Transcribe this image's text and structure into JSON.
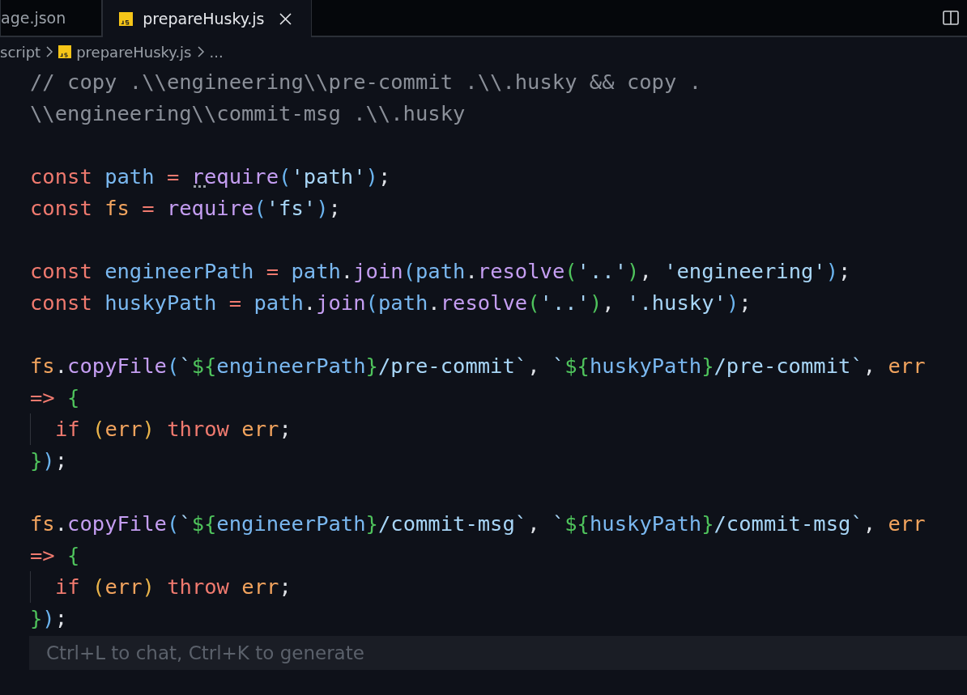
{
  "tabs": [
    {
      "label": "age.json",
      "selected": false,
      "kind": "plain"
    },
    {
      "label": "prepareHusky.js",
      "selected": true,
      "kind": "js"
    }
  ],
  "breadcrumb": [
    {
      "label": "script",
      "kind": "folder"
    },
    {
      "label": "prepareHusky.js",
      "kind": "js"
    },
    {
      "label": "...",
      "kind": "more"
    }
  ],
  "code_lines": [
    {
      "kind": "code",
      "guide": false,
      "tokens": [
        {
          "text": "// copy .\\\\engineering\\\\pre-commit .\\\\.husky && copy .",
          "kind": "comment"
        }
      ]
    },
    {
      "kind": "code",
      "guide": false,
      "tokens": [
        {
          "text": "\\\\engineering\\\\commit-msg .\\\\.husky",
          "kind": "comment"
        }
      ]
    },
    {
      "kind": "blank"
    },
    {
      "kind": "code",
      "guide": false,
      "hint": true,
      "tokens": [
        {
          "text": "const ",
          "kind": "keyword"
        },
        {
          "text": "path ",
          "kind": "variable"
        },
        {
          "text": "= ",
          "kind": "keyword"
        },
        {
          "text": "require",
          "kind": "function"
        },
        {
          "text": "(",
          "kind": "paren"
        },
        {
          "text": "'path'",
          "kind": "string"
        },
        {
          "text": ")",
          "kind": "paren"
        },
        {
          "text": ";",
          "kind": "punct"
        }
      ]
    },
    {
      "kind": "code",
      "guide": false,
      "tokens": [
        {
          "text": "const ",
          "kind": "keyword"
        },
        {
          "text": "fs ",
          "kind": "param"
        },
        {
          "text": "= ",
          "kind": "keyword"
        },
        {
          "text": "require",
          "kind": "function"
        },
        {
          "text": "(",
          "kind": "paren"
        },
        {
          "text": "'fs'",
          "kind": "string"
        },
        {
          "text": ")",
          "kind": "paren"
        },
        {
          "text": ";",
          "kind": "punct"
        }
      ]
    },
    {
      "kind": "blank"
    },
    {
      "kind": "code",
      "guide": false,
      "tokens": [
        {
          "text": "const ",
          "kind": "keyword"
        },
        {
          "text": "engineerPath ",
          "kind": "variable"
        },
        {
          "text": "= ",
          "kind": "keyword"
        },
        {
          "text": "path",
          "kind": "variable"
        },
        {
          "text": ".",
          "kind": "punct"
        },
        {
          "text": "join",
          "kind": "function"
        },
        {
          "text": "(",
          "kind": "paren"
        },
        {
          "text": "path",
          "kind": "variable"
        },
        {
          "text": ".",
          "kind": "punct"
        },
        {
          "text": "resolve",
          "kind": "function"
        },
        {
          "text": "(",
          "kind": "brace"
        },
        {
          "text": "'..'",
          "kind": "string"
        },
        {
          "text": ")",
          "kind": "brace"
        },
        {
          "text": ", ",
          "kind": "punct"
        },
        {
          "text": "'engineering'",
          "kind": "string"
        },
        {
          "text": ")",
          "kind": "paren"
        },
        {
          "text": ";",
          "kind": "punct"
        }
      ]
    },
    {
      "kind": "code",
      "guide": false,
      "tokens": [
        {
          "text": "const ",
          "kind": "keyword"
        },
        {
          "text": "huskyPath ",
          "kind": "variable"
        },
        {
          "text": "= ",
          "kind": "keyword"
        },
        {
          "text": "path",
          "kind": "variable"
        },
        {
          "text": ".",
          "kind": "punct"
        },
        {
          "text": "join",
          "kind": "function"
        },
        {
          "text": "(",
          "kind": "paren"
        },
        {
          "text": "path",
          "kind": "variable"
        },
        {
          "text": ".",
          "kind": "punct"
        },
        {
          "text": "resolve",
          "kind": "function"
        },
        {
          "text": "(",
          "kind": "brace"
        },
        {
          "text": "'..'",
          "kind": "string"
        },
        {
          "text": ")",
          "kind": "brace"
        },
        {
          "text": ", ",
          "kind": "punct"
        },
        {
          "text": "'.husky'",
          "kind": "string"
        },
        {
          "text": ")",
          "kind": "paren"
        },
        {
          "text": ";",
          "kind": "punct"
        }
      ]
    },
    {
      "kind": "blank"
    },
    {
      "kind": "code",
      "guide": false,
      "tokens": [
        {
          "text": "fs",
          "kind": "param"
        },
        {
          "text": ".",
          "kind": "punct"
        },
        {
          "text": "copyFile",
          "kind": "function"
        },
        {
          "text": "(",
          "kind": "paren"
        },
        {
          "text": "`",
          "kind": "string"
        },
        {
          "text": "${",
          "kind": "brace"
        },
        {
          "text": "engineerPath",
          "kind": "variable"
        },
        {
          "text": "}",
          "kind": "brace"
        },
        {
          "text": "/pre-commit`",
          "kind": "string"
        },
        {
          "text": ", ",
          "kind": "punct"
        },
        {
          "text": "`",
          "kind": "string"
        },
        {
          "text": "${",
          "kind": "brace"
        },
        {
          "text": "huskyPath",
          "kind": "variable"
        },
        {
          "text": "}",
          "kind": "brace"
        },
        {
          "text": "/pre-commit`",
          "kind": "string"
        },
        {
          "text": ", ",
          "kind": "punct"
        },
        {
          "text": "err",
          "kind": "param"
        }
      ]
    },
    {
      "kind": "code",
      "guide": false,
      "tokens": [
        {
          "text": "=> ",
          "kind": "keyword"
        },
        {
          "text": "{",
          "kind": "brace"
        }
      ]
    },
    {
      "kind": "code",
      "guide": true,
      "tokens": [
        {
          "text": "if ",
          "kind": "keyword"
        },
        {
          "text": "(",
          "kind": "yellow"
        },
        {
          "text": "err",
          "kind": "param"
        },
        {
          "text": ") ",
          "kind": "yellow"
        },
        {
          "text": "throw ",
          "kind": "keyword"
        },
        {
          "text": "err",
          "kind": "param"
        },
        {
          "text": ";",
          "kind": "punct"
        }
      ]
    },
    {
      "kind": "code",
      "guide": false,
      "tokens": [
        {
          "text": "}",
          "kind": "brace"
        },
        {
          "text": ")",
          "kind": "paren"
        },
        {
          "text": ";",
          "kind": "punct"
        }
      ]
    },
    {
      "kind": "blank"
    },
    {
      "kind": "code",
      "guide": false,
      "tokens": [
        {
          "text": "fs",
          "kind": "param"
        },
        {
          "text": ".",
          "kind": "punct"
        },
        {
          "text": "copyFile",
          "kind": "function"
        },
        {
          "text": "(",
          "kind": "paren"
        },
        {
          "text": "`",
          "kind": "string"
        },
        {
          "text": "${",
          "kind": "brace"
        },
        {
          "text": "engineerPath",
          "kind": "variable"
        },
        {
          "text": "}",
          "kind": "brace"
        },
        {
          "text": "/commit-msg`",
          "kind": "string"
        },
        {
          "text": ", ",
          "kind": "punct"
        },
        {
          "text": "`",
          "kind": "string"
        },
        {
          "text": "${",
          "kind": "brace"
        },
        {
          "text": "huskyPath",
          "kind": "variable"
        },
        {
          "text": "}",
          "kind": "brace"
        },
        {
          "text": "/commit-msg`",
          "kind": "string"
        },
        {
          "text": ", ",
          "kind": "punct"
        },
        {
          "text": "err",
          "kind": "param"
        }
      ]
    },
    {
      "kind": "code",
      "guide": false,
      "tokens": [
        {
          "text": "=> ",
          "kind": "keyword"
        },
        {
          "text": "{",
          "kind": "brace"
        }
      ]
    },
    {
      "kind": "code",
      "guide": true,
      "tokens": [
        {
          "text": "if ",
          "kind": "keyword"
        },
        {
          "text": "(",
          "kind": "yellow"
        },
        {
          "text": "err",
          "kind": "param"
        },
        {
          "text": ") ",
          "kind": "yellow"
        },
        {
          "text": "throw ",
          "kind": "keyword"
        },
        {
          "text": "err",
          "kind": "param"
        },
        {
          "text": ";",
          "kind": "punct"
        }
      ]
    },
    {
      "kind": "code",
      "guide": false,
      "tokens": [
        {
          "text": "}",
          "kind": "brace"
        },
        {
          "text": ")",
          "kind": "paren"
        },
        {
          "text": ";",
          "kind": "punct"
        }
      ]
    }
  ],
  "prompt": {
    "placeholder": "Ctrl+L to chat, Ctrl+K to generate"
  }
}
